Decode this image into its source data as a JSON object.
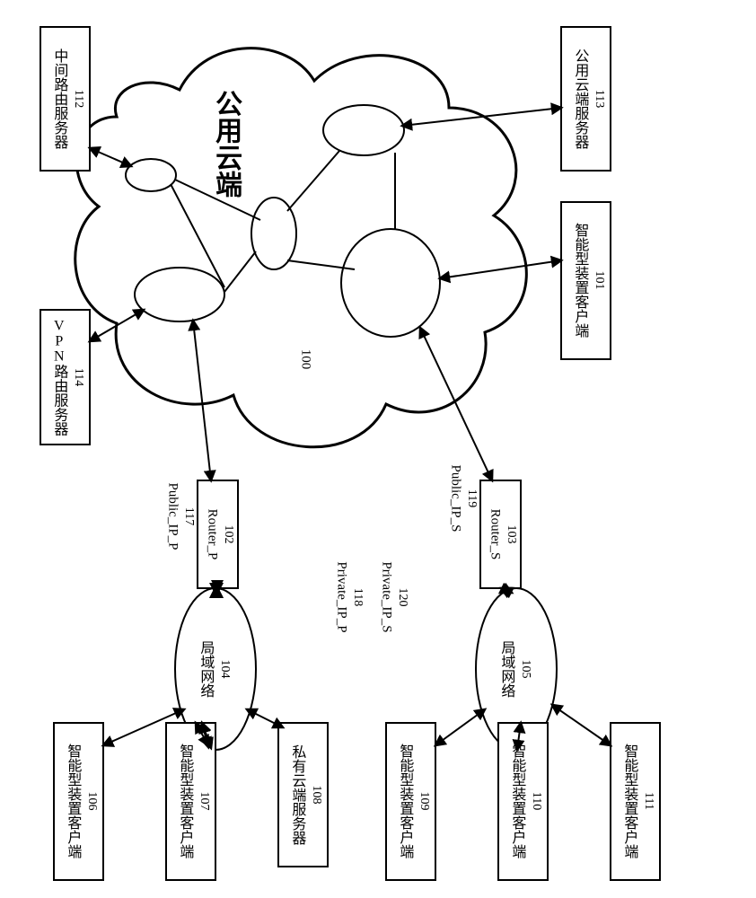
{
  "cloud": {
    "label": "公用云端",
    "id": "100"
  },
  "boxes": {
    "b112": {
      "text": "中间路由服务器",
      "id": "112"
    },
    "b113": {
      "text": "公用云端服务器",
      "id": "113"
    },
    "b114": {
      "text": "VPN路由服务器",
      "id": "114"
    },
    "b101": {
      "text": "智能型装置客户端",
      "id": "101"
    },
    "b102": {
      "text": "Router_P",
      "id": "102"
    },
    "b103": {
      "text": "Router_S",
      "id": "103"
    },
    "b104": {
      "text": "局域网络",
      "id": "104"
    },
    "b105": {
      "text": "局域网络",
      "id": "105"
    },
    "b106": {
      "text": "智能型装置客户端",
      "id": "106"
    },
    "b107": {
      "text": "智能型装置客户端",
      "id": "107"
    },
    "b108": {
      "text": "私有云端服务器",
      "id": "108"
    },
    "b109": {
      "text": "智能型装置客户端",
      "id": "109"
    },
    "b110": {
      "text": "智能型装置客户端",
      "id": "110"
    },
    "b111": {
      "text": "智能型装置客户端",
      "id": "111"
    }
  },
  "labels": {
    "l117": {
      "text": "Public_IP_P",
      "id": "117"
    },
    "l119": {
      "text": "Public_IP_S",
      "id": "119"
    },
    "l118": {
      "text": "Private_IP_P",
      "id": "118"
    },
    "l120": {
      "text": "Private_IP_S",
      "id": "120"
    }
  }
}
